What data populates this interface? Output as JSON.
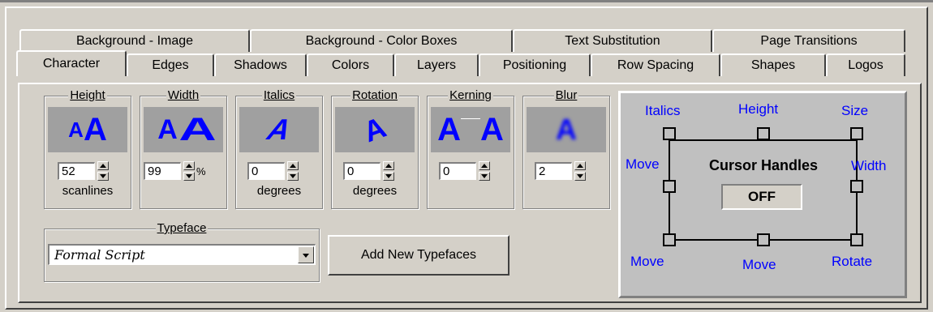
{
  "tabs_row1": [
    "Background - Image",
    "Background - Color Boxes",
    "Text Substitution",
    "Page Transitions"
  ],
  "tabs_row2": [
    "Character",
    "Edges",
    "Shadows",
    "Colors",
    "Layers",
    "Positioning",
    "Row Spacing",
    "Shapes",
    "Logos"
  ],
  "active_tab": "Character",
  "controls": {
    "height": {
      "title": "Height",
      "value": "52",
      "unit": "scanlines"
    },
    "width": {
      "title": "Width",
      "value": "99",
      "unit": "%"
    },
    "italics": {
      "title": "Italics",
      "value": "0",
      "unit": "degrees"
    },
    "rotation": {
      "title": "Rotation",
      "value": "0",
      "unit": "degrees"
    },
    "kerning": {
      "title": "Kerning",
      "value": "0",
      "unit": ""
    },
    "blur": {
      "title": "Blur",
      "value": "2",
      "unit": ""
    }
  },
  "typeface": {
    "title": "Typeface",
    "value": "Formal Script"
  },
  "add_typefaces_label": "Add New Typefaces",
  "cursor_handles": {
    "title": "Cursor Handles",
    "state": "OFF",
    "labels": {
      "italics": "Italics",
      "height": "Height",
      "size": "Size",
      "move_left": "Move",
      "width": "Width",
      "move_bl": "Move",
      "move_bottom": "Move",
      "rotate": "Rotate"
    }
  },
  "colors": {
    "accent_blue": "#0000ff",
    "face": "#d4d0c8",
    "preview_bg": "#a0a0a0"
  }
}
